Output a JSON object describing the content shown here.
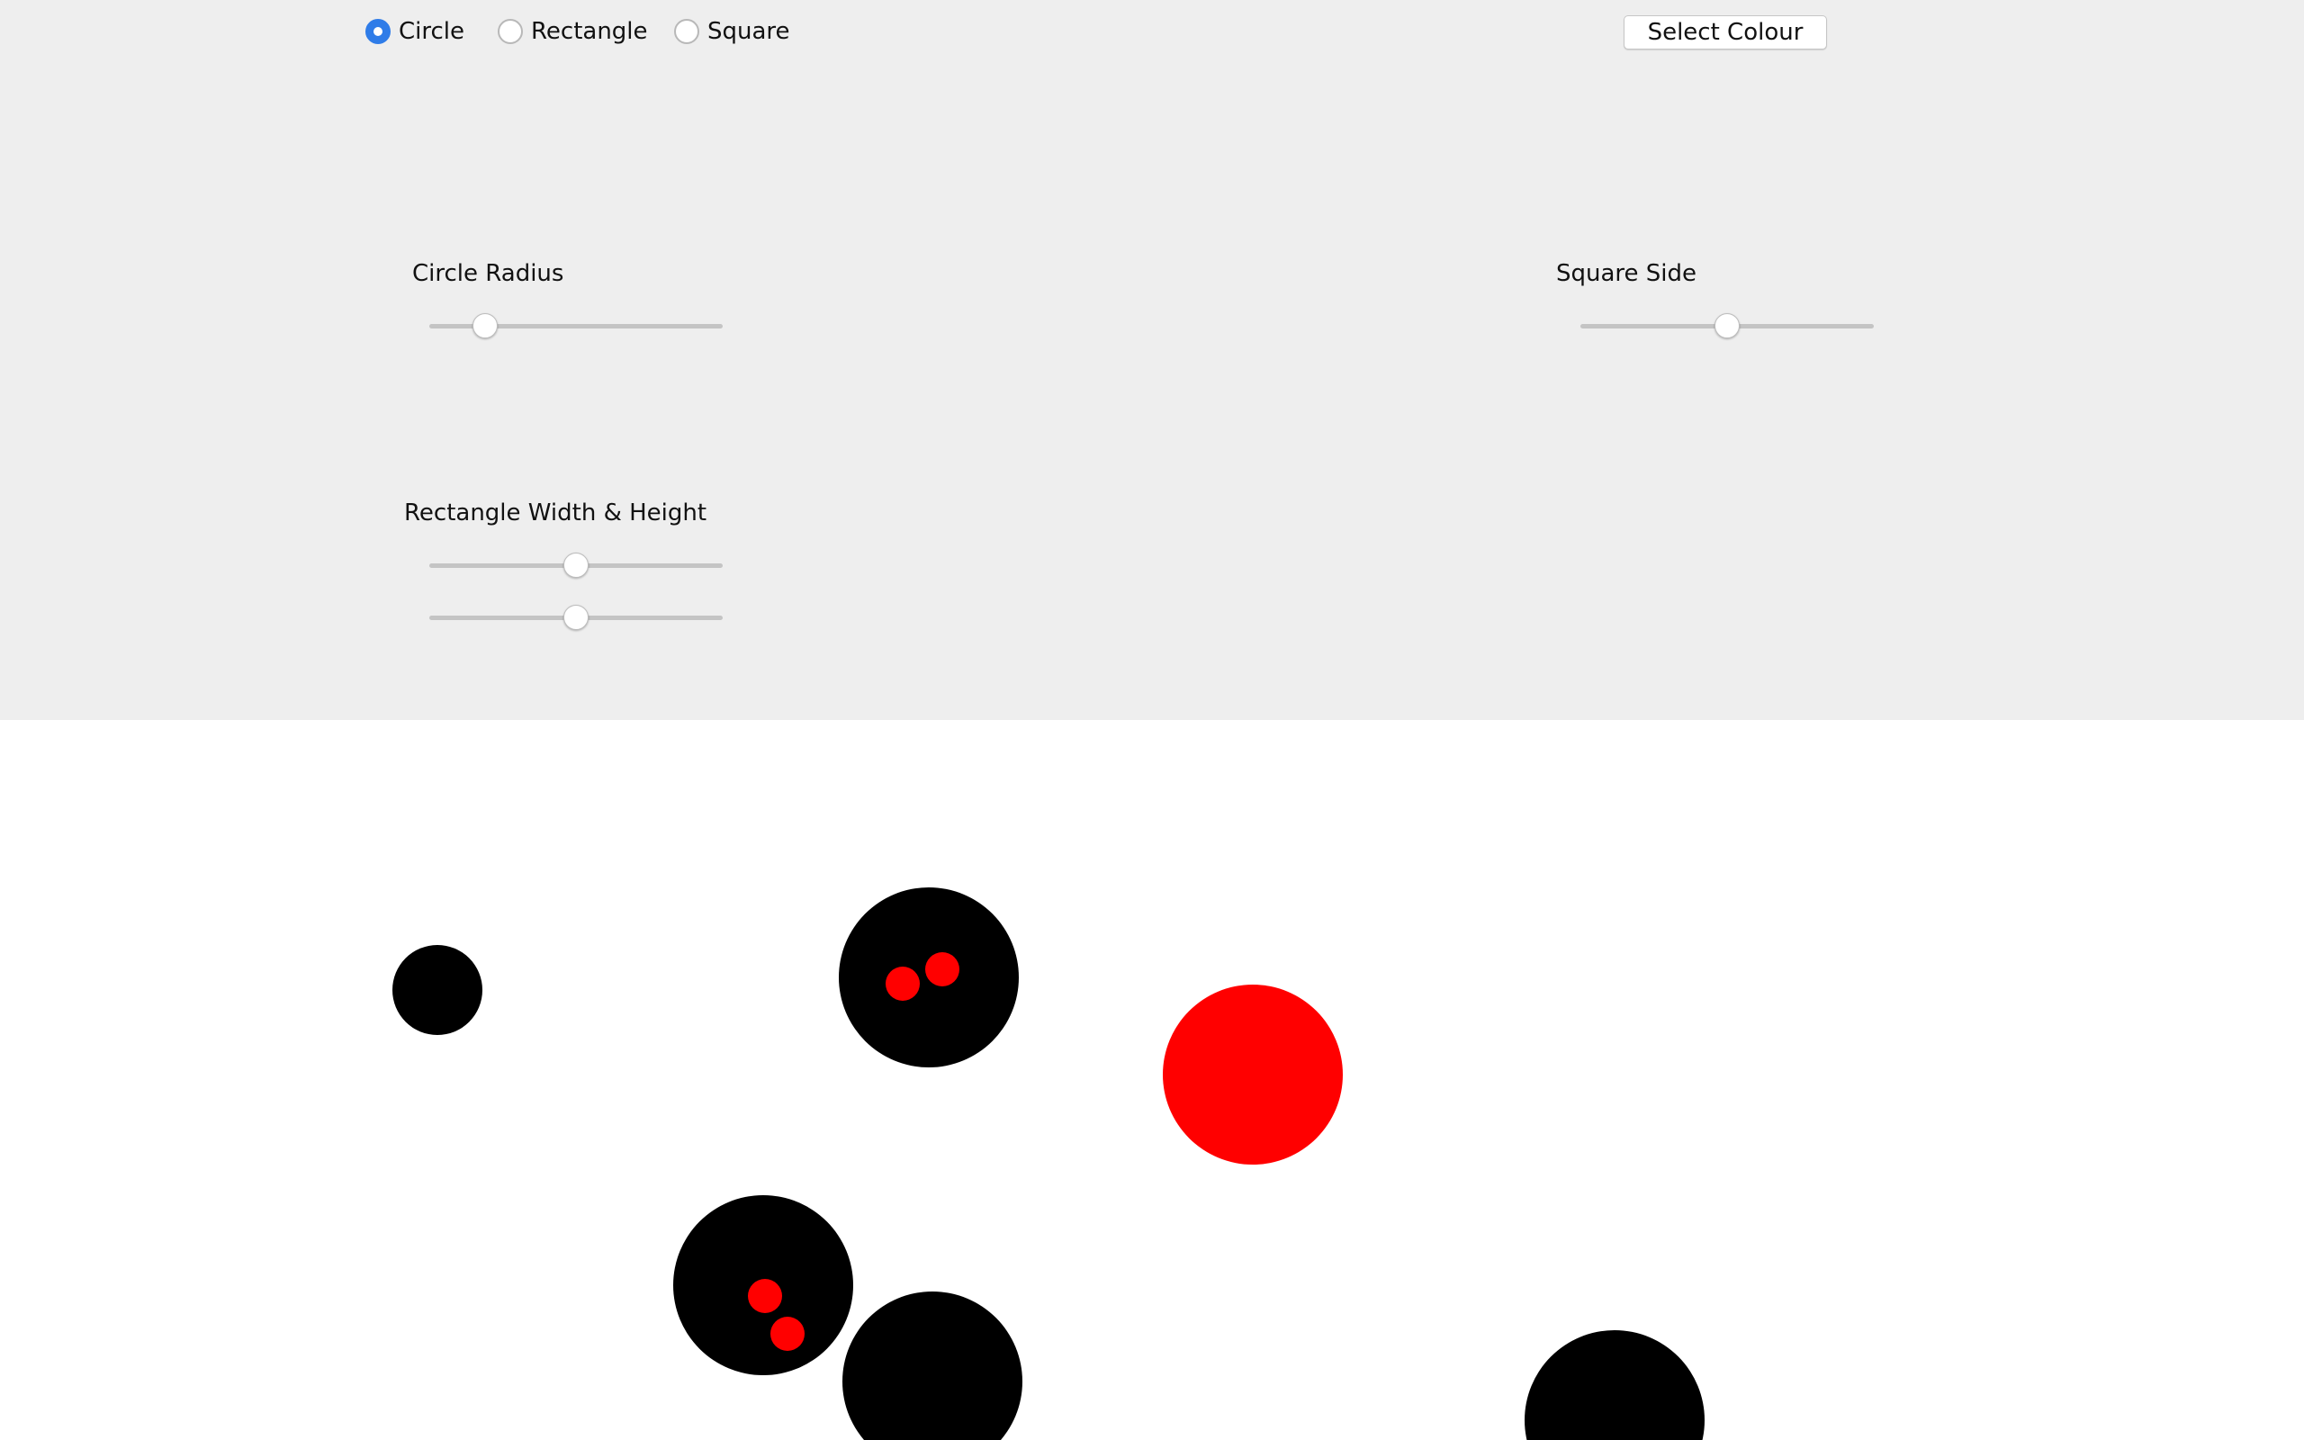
{
  "shape_selector": {
    "options": [
      {
        "id": "circle",
        "label": "Circle",
        "selected": true
      },
      {
        "id": "rectangle",
        "label": "Rectangle",
        "selected": false
      },
      {
        "id": "square",
        "label": "Square",
        "selected": false
      }
    ]
  },
  "colour_button": {
    "label": "Select Colour"
  },
  "circle_radius": {
    "label": "Circle Radius",
    "value": 0.19
  },
  "square_side": {
    "label": "Square Side",
    "value": 0.5
  },
  "rectangle_size": {
    "label": "Rectangle Width & Height",
    "width_value": 0.5,
    "height_value": 0.5
  },
  "colors": {
    "accent": "#2f7ce8",
    "panel_bg": "#eeeeee",
    "canvas_bg": "#ffffff",
    "black": "#000000",
    "red": "#ff0000"
  },
  "drawn_shapes": [
    {
      "type": "circle",
      "color": "black"
    },
    {
      "type": "circle",
      "color": "black"
    },
    {
      "type": "circle",
      "color": "red"
    },
    {
      "type": "circle",
      "color": "red"
    },
    {
      "type": "circle",
      "color": "red"
    },
    {
      "type": "circle",
      "color": "black"
    },
    {
      "type": "circle",
      "color": "red"
    },
    {
      "type": "circle",
      "color": "red"
    },
    {
      "type": "circle",
      "color": "black"
    },
    {
      "type": "circle",
      "color": "black"
    },
    {
      "type": "circle",
      "color": "red"
    }
  ]
}
